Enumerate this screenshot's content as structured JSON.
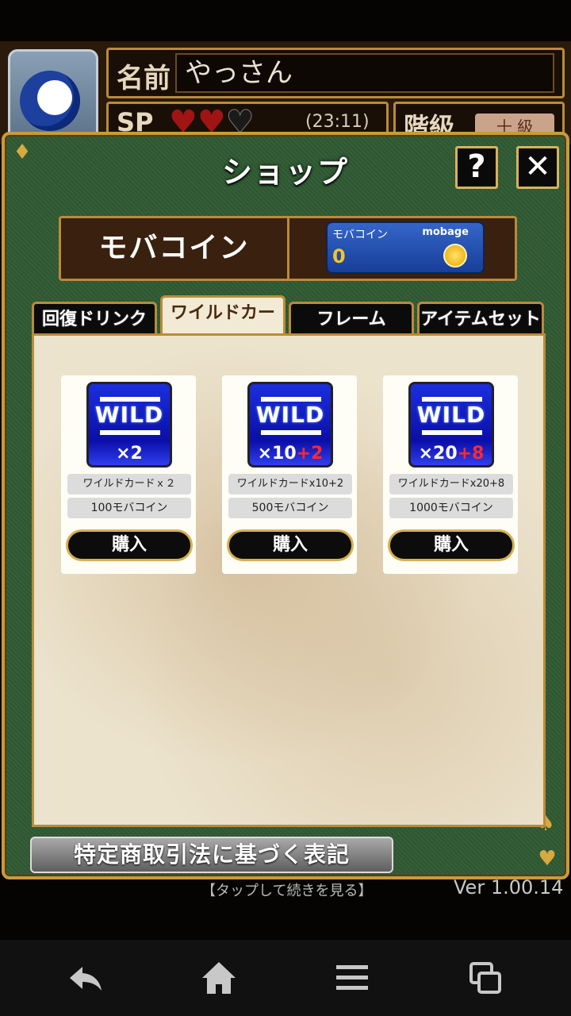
{
  "profile": {
    "name_label": "名前",
    "name_value": "やっさん",
    "sp_label": "SP",
    "sp_hearts": [
      "♥",
      "♥",
      "♥"
    ],
    "sp_timer": "(23:11)",
    "rank_label": "階級",
    "rank_value": "十 級"
  },
  "dialog": {
    "title": "ショップ",
    "help_label": "?",
    "close_label": "✕"
  },
  "coins": {
    "label": "モバコイン",
    "box_label": "モバコイン",
    "brand": "mobage",
    "amount": "0"
  },
  "tabs": [
    {
      "label": "回復ドリンク",
      "active": false
    },
    {
      "label": "ワイルドカード",
      "active": true
    },
    {
      "label": "フレーム",
      "active": false
    },
    {
      "label": "アイテムセット",
      "active": false
    }
  ],
  "items": [
    {
      "image_word": "WILD",
      "image_mult": "×2",
      "image_bonus": "",
      "name": "ワイルドカードｘ２",
      "price": "100モバコイン",
      "buy_label": "購入"
    },
    {
      "image_word": "WILD",
      "image_mult": "×10",
      "image_bonus": "+2",
      "name": "ワイルドカードx10+2",
      "price": "500モバコイン",
      "buy_label": "購入"
    },
    {
      "image_word": "WILD",
      "image_mult": "×20",
      "image_bonus": "+8",
      "name": "ワイルドカードx20+8",
      "price": "1000モバコイン",
      "buy_label": "購入"
    }
  ],
  "legal_button": "特定商取引法に基づく表記",
  "hint": "【タップして続きを見る】",
  "version": "Ver 1.00.14",
  "nav": {
    "back_icon": "back-arrow-icon",
    "home_icon": "home-icon",
    "menu_icon": "menu-icon",
    "tasks_icon": "recent-apps-icon"
  },
  "colors": {
    "felt_green": "#2f5a33",
    "gold_border": "#c79b3a",
    "wild_blue": "#0b0ea8",
    "bonus_red": "#ff2a2a"
  }
}
